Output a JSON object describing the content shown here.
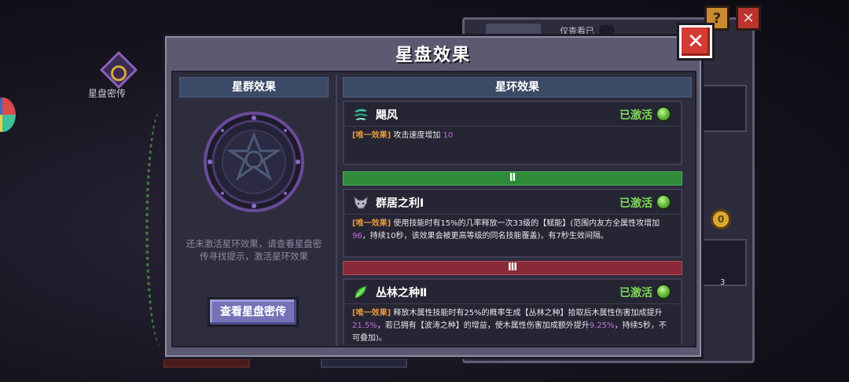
{
  "background": {
    "starchart_label": "星盘密传",
    "bg_tab_text": "仅查看已",
    "help_icon_glyph": "?",
    "close_bg_glyph": "✕",
    "coin_glyph": "0",
    "item_count": "3"
  },
  "modal": {
    "title": "星盘效果",
    "close_glyph": "✕"
  },
  "left": {
    "header": "星群效果",
    "empty_tip": "还未激活星环效果，请查看星盘密传寻找提示，激活星环效果",
    "view_button": "查看星盘密传"
  },
  "right": {
    "header": "星环效果",
    "tiers": [
      {
        "numeral": "Ⅱ",
        "color": "#2f8a3a"
      },
      {
        "numeral": "Ⅲ",
        "color": "#8a2a38"
      }
    ],
    "effects": [
      {
        "name": "飓风",
        "icon": "whirlwind-icon",
        "status": "已激活",
        "tag": "[唯一效果]",
        "desc_a": "攻击速度增加",
        "desc_num1": "10",
        "desc_b": "",
        "desc_num2": "",
        "desc_c": "",
        "desc_num3": "",
        "desc_d": ""
      },
      {
        "name": "群居之利Ⅰ",
        "icon": "wolf-icon",
        "status": "已激活",
        "tag": "[唯一效果]",
        "desc_a": "使用技能时有15%的几率释放一次33级的【赋能】(范围内友方全属性攻增加",
        "desc_num1": "96",
        "desc_b": "，持续10秒，该效果会被更高等级的同名技能覆盖)，有7秒生效间隔。",
        "desc_num2": "",
        "desc_c": "",
        "desc_num3": "",
        "desc_d": ""
      },
      {
        "name": "丛林之种Ⅱ",
        "icon": "leaf-seed-icon",
        "status": "已激活",
        "tag": "[唯一效果]",
        "desc_a": "释放木属性技能时有25%的概率生成【丛林之种】拾取后木属性伤害加成提升",
        "desc_num1": "21.5%",
        "desc_b": "，若已拥有【波涛之种】的增益，使木属性伤害加成额外提升",
        "desc_num2": "9.25%",
        "desc_c": "，持续5秒，不可叠加)。",
        "desc_num3": "",
        "desc_d": ""
      }
    ]
  },
  "colors": {
    "accent_active": "#7ed85a",
    "tag_orange": "#e89a3a",
    "number_purple": "#c46be0",
    "close_red": "#d43a34",
    "button_purple": "#7672b8"
  }
}
